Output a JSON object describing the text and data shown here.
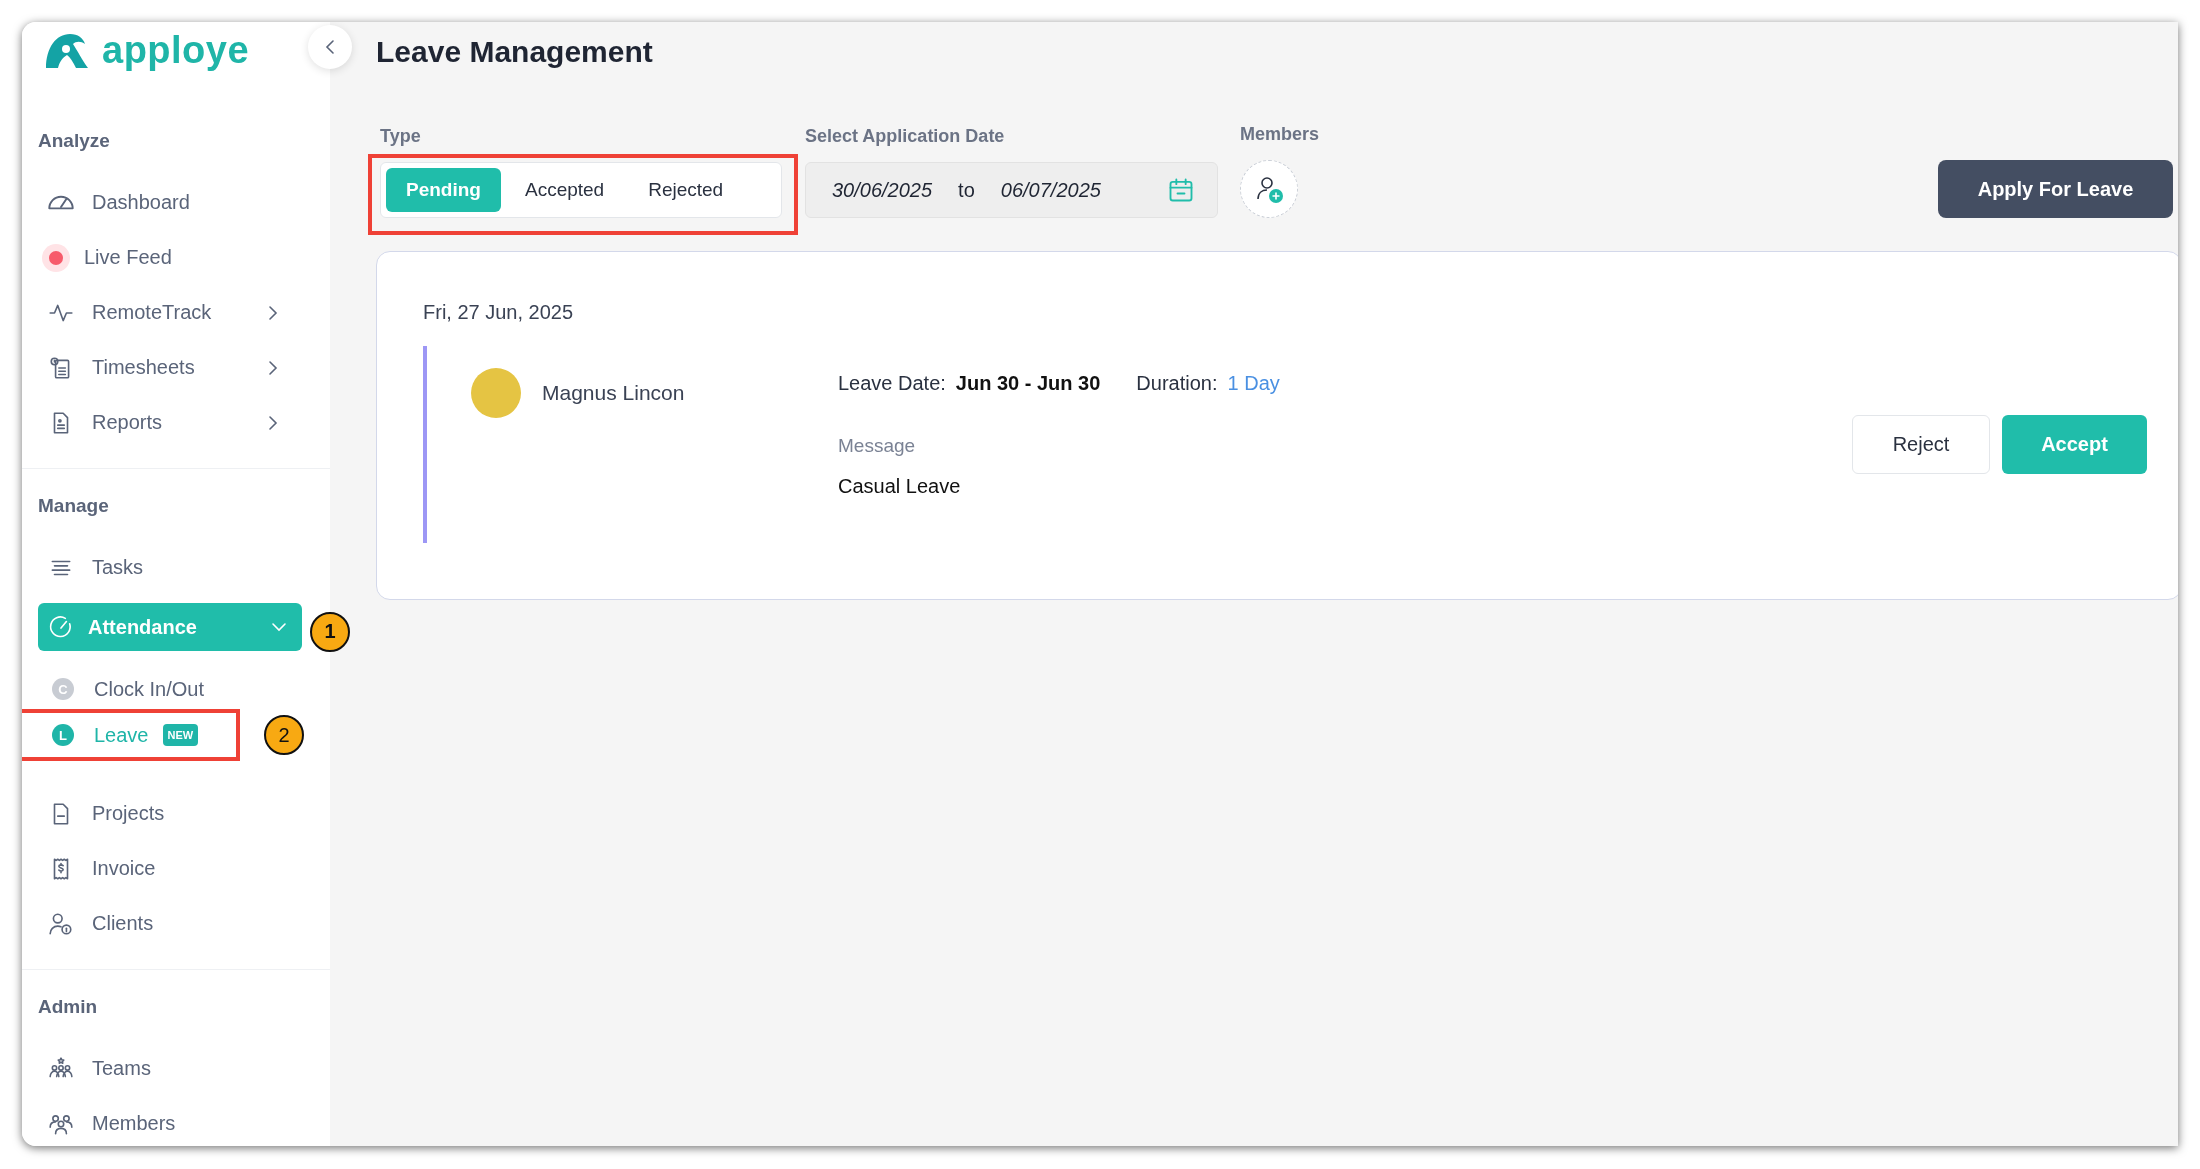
{
  "sidebar": {
    "logo": "apploye",
    "sections": [
      {
        "title": "Analyze",
        "items": [
          {
            "label": "Dashboard",
            "kind": "link",
            "has_submenu": false,
            "selected": false
          },
          {
            "label": "Live Feed",
            "kind": "live",
            "has_submenu": false,
            "selected": false
          },
          {
            "label": "RemoteTrack",
            "kind": "link",
            "has_submenu": true,
            "selected": false
          },
          {
            "label": "Timesheets",
            "kind": "link",
            "has_submenu": true,
            "selected": false
          },
          {
            "label": "Reports",
            "kind": "link",
            "has_submenu": true,
            "selected": false
          }
        ]
      },
      {
        "title": "Manage",
        "items": [
          {
            "label": "Tasks",
            "kind": "link",
            "has_submenu": false,
            "selected": false
          },
          {
            "label": "Attendance",
            "kind": "group",
            "selected": true,
            "expanded": true,
            "callout": "1",
            "children": [
              {
                "label": "Clock In/Out",
                "initial": "C",
                "selected": false,
                "highlighted": false
              },
              {
                "label": "Leave",
                "initial": "L",
                "selected": true,
                "badge": "NEW",
                "highlighted": true,
                "callout": "2"
              }
            ]
          },
          {
            "label": "Projects",
            "kind": "link",
            "has_submenu": false,
            "selected": false
          },
          {
            "label": "Invoice",
            "kind": "link",
            "has_submenu": false,
            "selected": false
          },
          {
            "label": "Clients",
            "kind": "link",
            "has_submenu": false,
            "selected": false
          }
        ]
      },
      {
        "title": "Admin",
        "items": [
          {
            "label": "Teams",
            "kind": "link",
            "has_submenu": false,
            "selected": false
          },
          {
            "label": "Members",
            "kind": "link",
            "has_submenu": false,
            "selected": false
          }
        ]
      }
    ]
  },
  "page": {
    "title": "Leave Management",
    "type_filter": {
      "label": "Type",
      "highlighted": true,
      "options": [
        {
          "label": "Pending",
          "selected": true
        },
        {
          "label": "Accepted",
          "selected": false
        },
        {
          "label": "Rejected",
          "selected": false
        }
      ]
    },
    "date_filter": {
      "label": "Select Application Date",
      "from": "30/06/2025",
      "separator": "to",
      "to": "06/07/2025"
    },
    "members_filter": {
      "label": "Members"
    },
    "apply_button": "Apply For Leave"
  },
  "requests": [
    {
      "date": "Fri, 27 Jun, 2025",
      "entries": [
        {
          "name": "Magnus Lincon",
          "leave_date_label": "Leave Date:",
          "leave_date": "Jun 30 - Jun 30",
          "duration_label": "Duration:",
          "duration": "1 Day",
          "message_label": "Message",
          "message": "Casual Leave",
          "actions": [
            {
              "label": "Reject",
              "kind": "secondary"
            },
            {
              "label": "Accept",
              "kind": "primary"
            }
          ]
        }
      ]
    }
  ]
}
